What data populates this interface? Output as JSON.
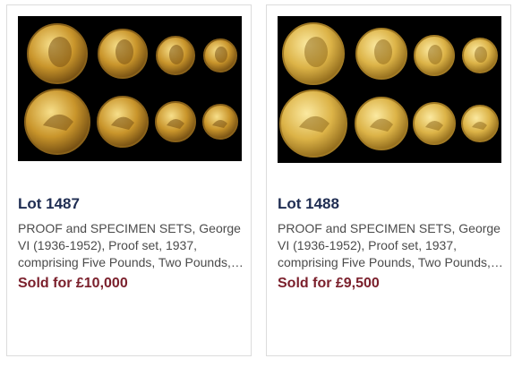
{
  "lots": [
    {
      "lot_label": "Lot 1487",
      "description": "PROOF and SPECIMEN SETS, George VI (1936-1952), Proof set, 1937, comprising Five Pounds, Two Pounds, Sovereign and Half Sovereign",
      "price_label": "Sold for £10,000",
      "image": {
        "subject": "coin-set-proof",
        "background": "#000000",
        "coin_color": "#d9a93a"
      }
    },
    {
      "lot_label": "Lot 1488",
      "description": "PROOF and SPECIMEN SETS, George VI (1936-1952), Proof set, 1937, comprising Five Pounds, Two Pounds, Sovereign and Half Sovereign",
      "price_label": "Sold for £9,500",
      "image": {
        "subject": "coin-set-specimen",
        "background": "#000000",
        "coin_color": "#e6c25a"
      }
    }
  ]
}
